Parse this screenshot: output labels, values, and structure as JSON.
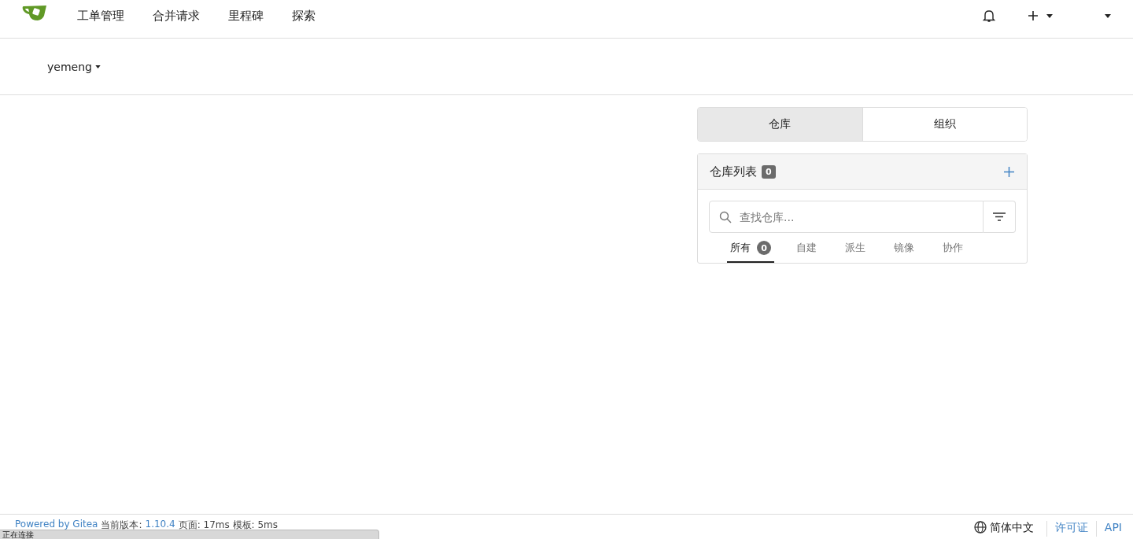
{
  "nav": {
    "items": [
      "工单管理",
      "合并请求",
      "里程碑",
      "探索"
    ]
  },
  "context": {
    "user": "yemeng"
  },
  "switch_tabs": [
    {
      "label": "仓库",
      "selected": true
    },
    {
      "label": "组织",
      "selected": false
    }
  ],
  "repo_list": {
    "title": "仓库列表",
    "count": "0",
    "search": {
      "placeholder": "查找仓库..."
    },
    "filters": [
      {
        "label": "所有",
        "count": "0",
        "selected": true
      },
      {
        "label": "自建",
        "selected": false
      },
      {
        "label": "派生",
        "selected": false
      },
      {
        "label": "镜像",
        "selected": false
      },
      {
        "label": "协作",
        "selected": false
      }
    ]
  },
  "footer": {
    "powered": "Powered by Gitea",
    "version_label": "当前版本:",
    "version": "1.10.4",
    "timing": "页面: 17ms 模板: 5ms",
    "language": "简体中文",
    "links": [
      "许可证",
      "API"
    ]
  },
  "status_bar": "正在连接"
}
